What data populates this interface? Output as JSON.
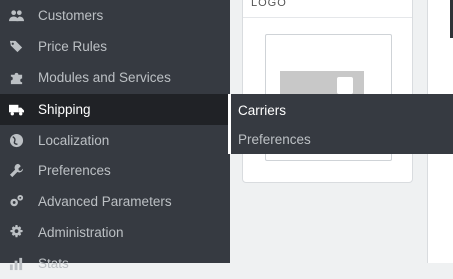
{
  "sidebar": {
    "items": [
      {
        "label": "Customers",
        "icon": "users-icon"
      },
      {
        "label": "Price Rules",
        "icon": "tags-icon"
      },
      {
        "label": "Modules and Services",
        "icon": "puzzle-icon"
      },
      {
        "label": "Shipping",
        "icon": "truck-icon",
        "active": true
      },
      {
        "label": "Localization",
        "icon": "globe-icon"
      },
      {
        "label": "Preferences",
        "icon": "wrench-icon"
      },
      {
        "label": "Advanced Parameters",
        "icon": "cogs-icon"
      },
      {
        "label": "Administration",
        "icon": "gear-icon"
      },
      {
        "label": "Stats",
        "icon": "bar-chart-icon"
      }
    ]
  },
  "submenu": {
    "items": [
      {
        "label": "Carriers",
        "selected": true
      },
      {
        "label": "Preferences"
      }
    ]
  },
  "card": {
    "header": "LOGO"
  },
  "colors": {
    "sidebar_bg": "#363a41",
    "active_bg": "#202226",
    "text": "#bcc0c4",
    "active_text": "#ffffff"
  }
}
